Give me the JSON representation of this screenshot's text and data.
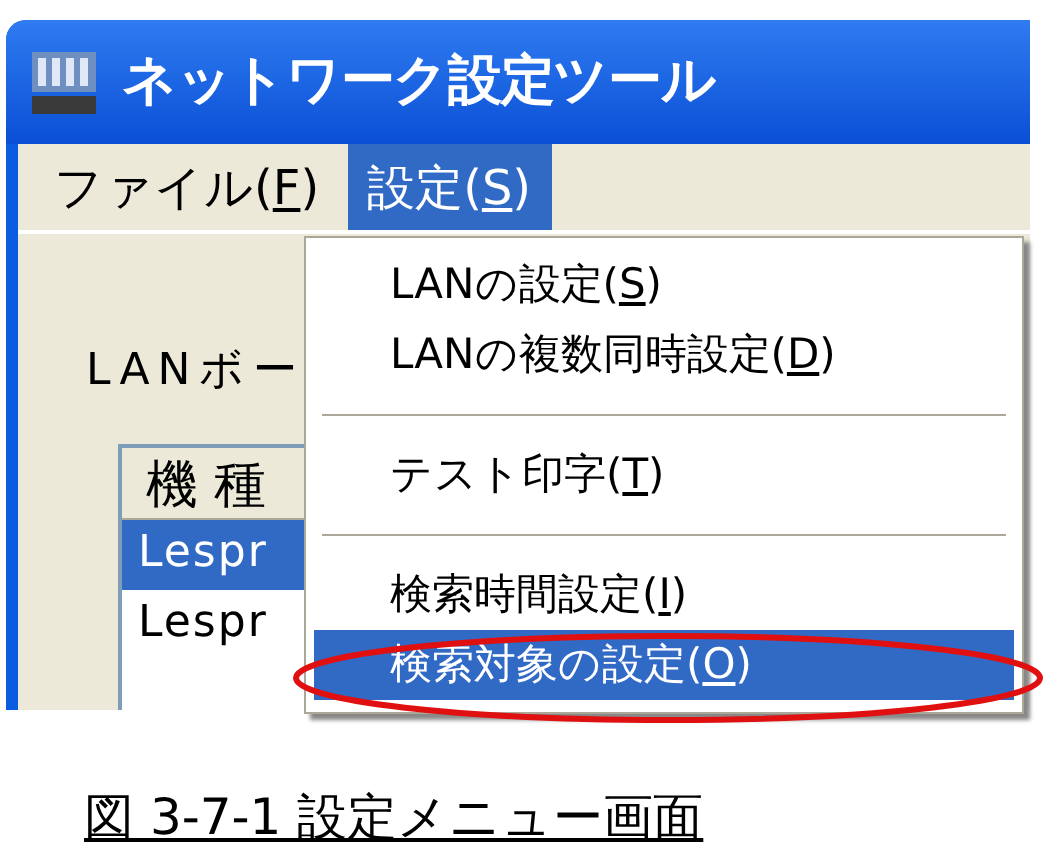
{
  "window": {
    "title": "ネットワーク設定ツール"
  },
  "menu_bar": [
    {
      "label": "ファイル(F)",
      "selected": false
    },
    {
      "label": "設定(S)",
      "selected": true
    }
  ],
  "dropdown": [
    {
      "kind": "item",
      "label": "LANの設定(S)",
      "selected": false
    },
    {
      "kind": "item",
      "label": "LANの複数同時設定(D)",
      "selected": false
    },
    {
      "kind": "separator"
    },
    {
      "kind": "item",
      "label": "テスト印字(T)",
      "selected": false
    },
    {
      "kind": "separator"
    },
    {
      "kind": "item",
      "label": "検索時間設定(I)",
      "selected": false
    },
    {
      "kind": "item",
      "label": "検索対象の設定(O)",
      "selected": true
    }
  ],
  "background": {
    "label": "LANボー",
    "list_header": "機種",
    "rows": [
      {
        "text": "Lespr",
        "selected": true
      },
      {
        "text": "Lespr",
        "selected": false
      }
    ]
  },
  "caption": "図 3-7-1 設定メニュー画面"
}
